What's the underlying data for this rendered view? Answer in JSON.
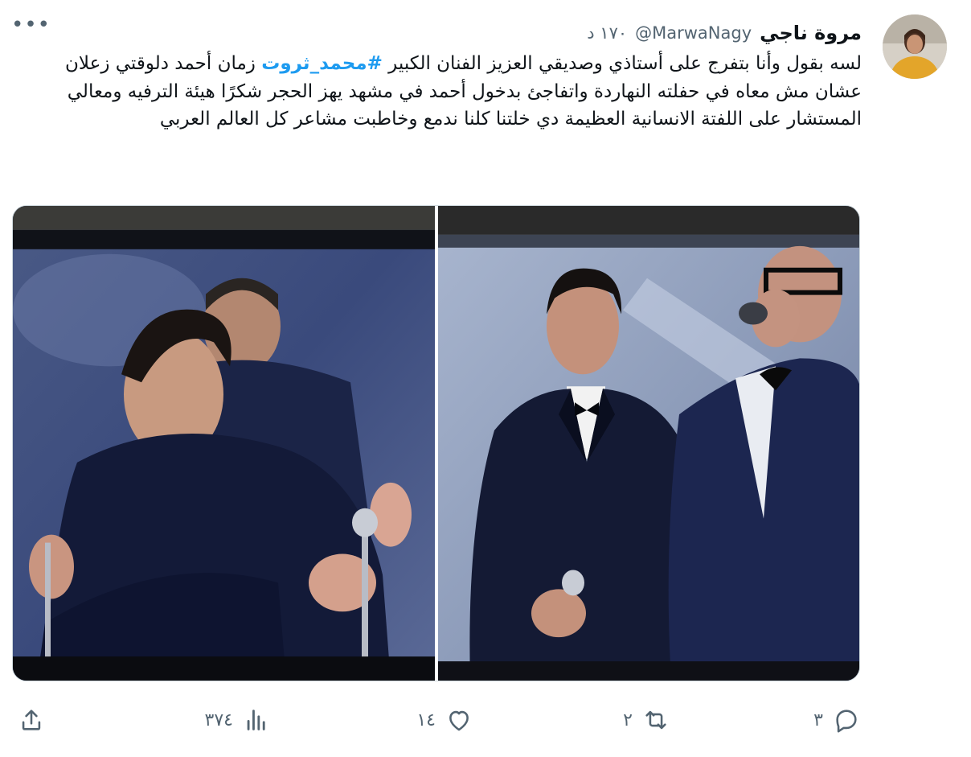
{
  "author": {
    "name": "مروة ناجي",
    "handle": "@MarwaNagy",
    "time": "١٧٠ د"
  },
  "tweet": {
    "text_before": "لسه بقول وأنا بتفرج على أستاذي وصديقي العزيز الفنان الكبير ",
    "hashtag": "#محمد_ثروت",
    "text_after": " زمان أحمد دلوقتي زعلان عشان مش معاه في حفلته النهاردة واتفاجئ بدخول أحمد في مشهد يهز الحجر شكرًا هيئة الترفيه ومعالي المستشار على اللفتة الانسانية العظيمة دي خلتنا كلنا ندمع وخاطبت مشاعر كل العالم العربي"
  },
  "media": {
    "photos": [
      "hug-photo",
      "stage-photo"
    ]
  },
  "actions": {
    "replies": "٣",
    "retweets": "٢",
    "likes": "١٤",
    "views": "٣٧٤"
  },
  "icons": [
    "more-icon",
    "reply-icon",
    "retweet-icon",
    "like-icon",
    "views-icon",
    "share-icon"
  ],
  "colors": {
    "accent": "#1d9bf0",
    "secondary_text": "#536471",
    "primary_text": "#0f1419"
  }
}
